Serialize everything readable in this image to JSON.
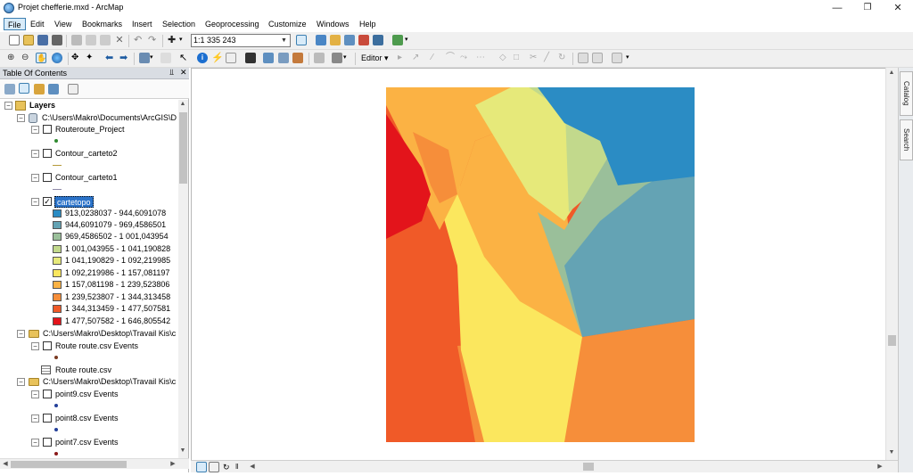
{
  "window": {
    "title": "Projet chefferie.mxd - ArcMap"
  },
  "menu": [
    "File",
    "Edit",
    "View",
    "Bookmarks",
    "Insert",
    "Selection",
    "Geoprocessing",
    "Customize",
    "Windows",
    "Help"
  ],
  "toolbar": {
    "scale": "1:1 335 243",
    "editor_label": "Editor"
  },
  "toc": {
    "title": "Table Of Contents",
    "root_label": "Layers",
    "workspace1": "C:\\Users\\Makro\\Documents\\ArcGIS\\D",
    "layers": {
      "routeroute": "Routeroute_Project",
      "contour2": "Contour_carteto2",
      "contour1": "Contour_carteto1",
      "cartetopo": "cartetopo"
    },
    "classes": [
      {
        "label": "913,0238037 - 944,6091078",
        "color": "#2b8cc4"
      },
      {
        "label": "944,6091079 - 969,4586501",
        "color": "#64a3b4"
      },
      {
        "label": "969,4586502 - 1 001,043954",
        "color": "#9abf9a"
      },
      {
        "label": "1 001,043955 - 1 041,190828",
        "color": "#c2d98c"
      },
      {
        "label": "1 041,190829 - 1 092,219985",
        "color": "#e6e97a"
      },
      {
        "label": "1 092,219986 - 1 157,081197",
        "color": "#fbe75e"
      },
      {
        "label": "1 157,081198 - 1 239,523806",
        "color": "#fbb244"
      },
      {
        "label": "1 239,523807 - 1 344,313458",
        "color": "#f68e3a"
      },
      {
        "label": "1 344,313459 - 1 477,507581",
        "color": "#f05a28"
      },
      {
        "label": "1 477,507582 - 1 646,805542",
        "color": "#e3141b"
      }
    ],
    "workspace2": "C:\\Users\\Makro\\Desktop\\Travail Kis\\c",
    "route_events": "Route route.csv Events",
    "route_table": "Route route.csv",
    "workspace3": "C:\\Users\\Makro\\Desktop\\Travail Kis\\c",
    "point9": "point9.csv Events",
    "point8": "point8.csv Events",
    "point7": "point7.csv Events"
  },
  "side_tabs": {
    "catalog": "Catalog",
    "search": "Search"
  }
}
